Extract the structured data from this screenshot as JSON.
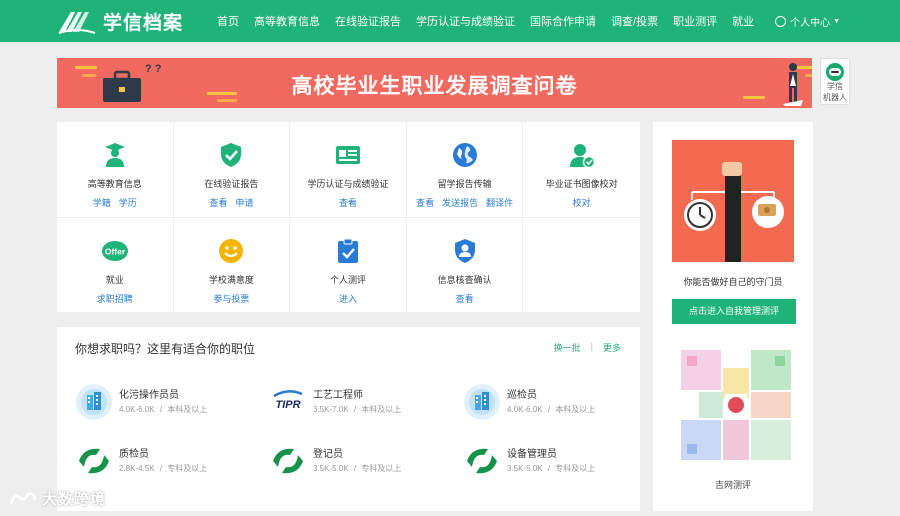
{
  "header": {
    "logo_text": "学信档案",
    "nav": [
      "首页",
      "高等教育信息",
      "在线验证报告",
      "学历认证与成绩验证",
      "国际合作申请",
      "调查/投票",
      "职业测评",
      "就业"
    ],
    "user_menu": "个人中心"
  },
  "banner": {
    "title": "高校毕业生职业发展调查问卷"
  },
  "robot": {
    "line1": "学信",
    "line2": "机器人"
  },
  "services": [
    {
      "name": "高等教育信息",
      "links": [
        "学籍",
        "学历"
      ],
      "icon": "graduate-icon",
      "color": "#1fb37a"
    },
    {
      "name": "在线验证报告",
      "links": [
        "查看",
        "申请"
      ],
      "icon": "shield-check-icon",
      "color": "#1fb37a"
    },
    {
      "name": "学历认证与成绩验证",
      "links": [
        "查看"
      ],
      "icon": "id-card-icon",
      "color": "#1fb37a"
    },
    {
      "name": "留学报告传输",
      "links": [
        "查看",
        "发送报告",
        "翻译件"
      ],
      "icon": "globe-icon",
      "color": "#2a7bd6"
    },
    {
      "name": "毕业证书图像校对",
      "links": [
        "校对"
      ],
      "icon": "user-check-icon",
      "color": "#1fb37a"
    },
    {
      "name": "就业",
      "links": [
        "求职招聘"
      ],
      "icon": "offer-icon",
      "color": "#1fb37a"
    },
    {
      "name": "学校满意度",
      "links": [
        "参与投票"
      ],
      "icon": "smile-icon",
      "color": "#f5b400"
    },
    {
      "name": "个人测评",
      "links": [
        "进入"
      ],
      "icon": "clipboard-check-icon",
      "color": "#2a7bd6"
    },
    {
      "name": "信息核查确认",
      "links": [
        "查看"
      ],
      "icon": "user-shield-icon",
      "color": "#2a7bd6"
    }
  ],
  "jobs": {
    "heading": "你想求职吗？这里有适合你的职位",
    "refresh": "换一批",
    "more": "更多",
    "items": [
      {
        "title": "化污操作员员",
        "salary": "4.0K-6.0K",
        "edu": "本科及以上",
        "logo": "building-logo-icon"
      },
      {
        "title": "工艺工程师",
        "salary": "3.5K-7.0K",
        "edu": "本科及以上",
        "logo": "tipr-logo-icon",
        "logo_text": "TIPR"
      },
      {
        "title": "巡检员",
        "salary": "4.0K-6.0K",
        "edu": "本科及以上",
        "logo": "building-logo-icon"
      },
      {
        "title": "质检员",
        "salary": "2.8K-4.5K",
        "edu": "专科及以上",
        "logo": "green-swirl-logo-icon"
      },
      {
        "title": "登记员",
        "salary": "3.5K-5.0K",
        "edu": "专科及以上",
        "logo": "green-swirl-logo-icon"
      },
      {
        "title": "设备管理员",
        "salary": "3.5K-5.0K",
        "edu": "专科及以上",
        "logo": "green-swirl-logo-icon"
      }
    ],
    "separator": "/"
  },
  "side": {
    "caption": "你能否做好自己的守门员",
    "button": "点击进入自我管理测评",
    "qr_caption": "吉网测评"
  },
  "watermark": {
    "text": "大数跨境"
  },
  "colors": {
    "brand": "#1fb37a",
    "banner": "#f26a5f",
    "link": "#2a7bd6"
  }
}
